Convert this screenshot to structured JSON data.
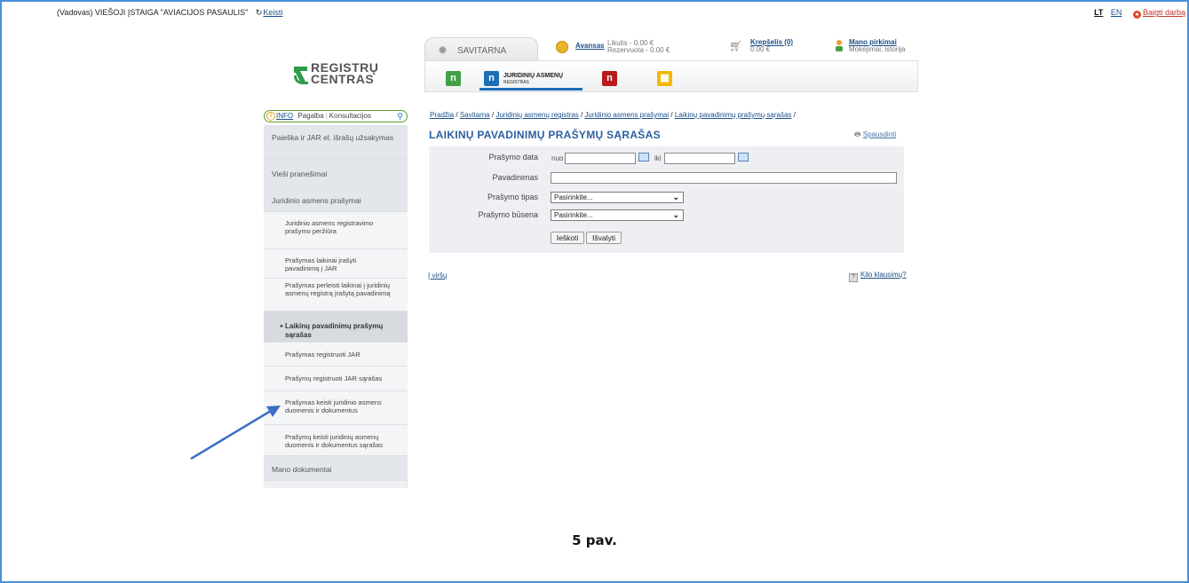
{
  "topbar": {
    "role": "(Vadovas)",
    "company": "VIEŠOJI ĮSTAIGA \"AVIACIJOS PASAULIS\"",
    "change_link": "Keisti",
    "lang_lt": "LT",
    "lang_en": "EN",
    "logout": "Baigti darbą"
  },
  "logo": {
    "line1": "REGISTRŲ",
    "line2": "CENTRAS"
  },
  "header": {
    "savitarna": "SAVITARNA",
    "avansas_link": "Avansas",
    "likutis": "Likutis - 0.00 €",
    "rezervuota": "Rezervuota - 0.00 €",
    "krepselis_link": "Krepšelis (0)",
    "krepselis_sum": "0.00 €",
    "pirkimai_link": "Mano pirkimai",
    "pirkimai_sub": "Mokėjimai, istorija",
    "active_registry_line1": "JURIDINIŲ ASMENŲ",
    "active_registry_line2": "REGISTRAS",
    "colors": {
      "green": "#43a047",
      "blue": "#1a6fb5",
      "red": "#b71c1c",
      "yellow": "#f2b705"
    }
  },
  "search": {
    "info": "INFO",
    "pagalba": "Pagalba",
    "konsultacijos": "Konsultacijos"
  },
  "sidebar": {
    "items": [
      {
        "label": "Paieška ir JAR el. išrašų užsakymas"
      },
      {
        "label": "Vieši pranešimai"
      },
      {
        "label": "Juridinio asmens prašymai"
      },
      {
        "label": "Juridinio asmens registravimo prašymo peržiūra"
      },
      {
        "label": "Prašymas laikinai įrašyti pavadinimą į JAR"
      },
      {
        "label": "Prašymas perleisti laikinai į juridinių asmenų registrą įrašytą pavadinimą"
      },
      {
        "label": "Laikinų pavadinimų prašymų sąrašas"
      },
      {
        "label": "Prašymas registruoti JAR"
      },
      {
        "label": "Prašymų registruoti JAR sąrašas"
      },
      {
        "label": "Prašymas keisti juridinio asmens duomenis ir dokumentus"
      },
      {
        "label": "Prašymų keisti juridinių asmenų duomenis ir dokumentus sąrašas"
      },
      {
        "label": "Mano dokumentai"
      }
    ]
  },
  "breadcrumb": {
    "items": [
      "Pradžia",
      "Savitarna",
      "Juridinių asmenų registras",
      "Juridinio asmens prašymai",
      "Laikinų pavadinimų prašymų sąrašas"
    ],
    "sep": "/"
  },
  "main": {
    "title": "LAIKINŲ PAVADINIMŲ PRAŠYMŲ SĄRAŠAS",
    "print": "Spausdinti",
    "form": {
      "date_label": "Prašymo data",
      "from": "nuo",
      "to": "iki",
      "from_value": "",
      "to_value": "",
      "name_label": "Pavadinimas",
      "name_value": "",
      "type_label": "Prašymo tipas",
      "type_selected": "Pasirinkite...",
      "status_label": "Prašymo būsena",
      "status_selected": "Pasirinkite...",
      "search_btn": "Ieškoti",
      "clear_btn": "Išvalyti"
    },
    "top_link": "Į viršų",
    "faq": "Kilo klausimų?"
  },
  "caption": "5 pav.",
  "annotation_color": "#3b6fc4"
}
